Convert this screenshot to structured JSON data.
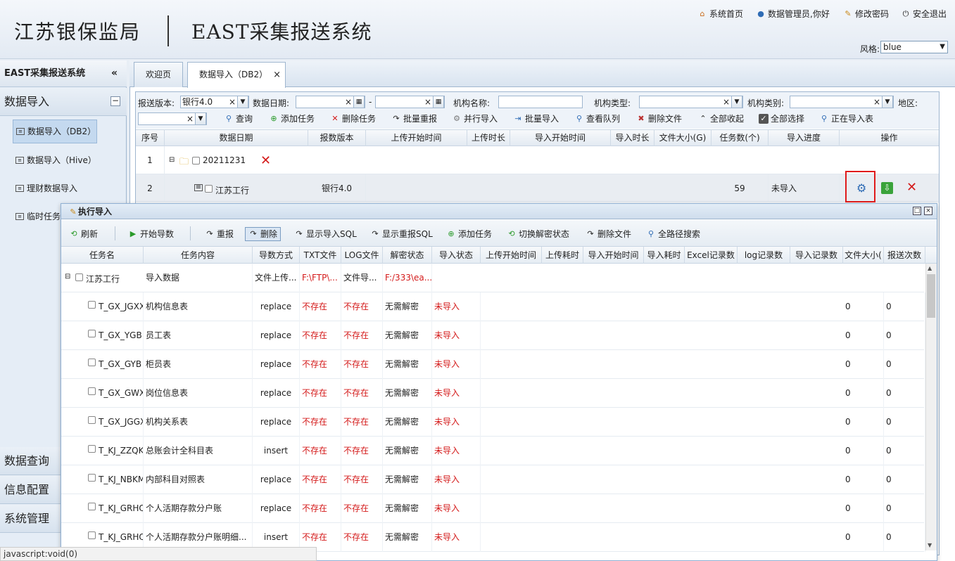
{
  "header": {
    "org_title": "江苏银保监局",
    "system_title": "EAST采集报送系统",
    "links": {
      "home": "系统首页",
      "user": "数据管理员,你好",
      "password": "修改密码",
      "logout": "安全退出"
    },
    "style_label": "风格:",
    "style_value": "blue"
  },
  "sidebar": {
    "title": "EAST采集报送系统",
    "collapse": "«",
    "group_data_import": "数据导入",
    "items": [
      "数据导入（DB2）",
      "数据导入（Hive）",
      "理财数据导入",
      "临时任务"
    ],
    "groups": [
      "数据查询",
      "信息配置",
      "系统管理"
    ]
  },
  "tabs": [
    {
      "label": "欢迎页"
    },
    {
      "label": "数据导入（DB2）",
      "close": "×"
    }
  ],
  "filters": {
    "version_label": "报送版本:",
    "version_value": "银行4.0",
    "date_label": "数据日期:",
    "date_sep": "-",
    "org_name_label": "机构名称:",
    "org_type_label": "机构类型:",
    "org_category_label": "机构类别:",
    "region_label": "地区:"
  },
  "toolbar": {
    "query": "查询",
    "add_task": "添加任务",
    "delete_task": "删除任务",
    "batch_resend": "批量重报",
    "parallel_import": "并行导入",
    "batch_import": "批量导入",
    "view_queue": "查看队列",
    "delete_file": "删除文件",
    "collapse_all": "全部收起",
    "select_all": "全部选择",
    "importing": "正在导入表"
  },
  "grid": {
    "columns": [
      "序号",
      "数据日期",
      "报数版本",
      "上传开始时间",
      "上传时长",
      "导入开始时间",
      "导入时长",
      "文件大小(G)",
      "任务数(个)",
      "导入进度",
      "操作"
    ],
    "rows": [
      {
        "seq": "1",
        "date": "20211231"
      },
      {
        "seq": "2",
        "org": "江苏工行",
        "version": "银行4.0",
        "tasks": "59",
        "progress": "未导入"
      }
    ]
  },
  "dialog": {
    "title": "执行导入",
    "toolbar": [
      "刷新",
      "开始导数",
      "重报",
      "删除",
      "显示导入SQL",
      "显示重报SQL",
      "添加任务",
      "切换解密状态",
      "删除文件",
      "全路径搜索"
    ],
    "columns": [
      "任务名",
      "任务内容",
      "导数方式",
      "TXT文件",
      "LOG文件",
      "解密状态",
      "导入状态",
      "上传开始时间",
      "上传耗时",
      "导入开始时间",
      "导入耗时",
      "Excel记录数",
      "log记录数",
      "导入记录数",
      "文件大小(",
      "报送次数"
    ],
    "parent_row": {
      "name": "江苏工行",
      "content": "导入数据",
      "mode": "文件上传...",
      "txt": "F:\\FTP\\...",
      "log": "文件导...",
      "decrypt": "F:/333\\ea..."
    },
    "rows": [
      {
        "name": "T_GX_JGXX",
        "content": "机构信息表",
        "mode": "replace",
        "txt": "不存在",
        "log": "不存在",
        "decrypt": "无需解密",
        "status": "未导入",
        "size": "0",
        "count": "0"
      },
      {
        "name": "T_GX_YGB",
        "content": "员工表",
        "mode": "replace",
        "txt": "不存在",
        "log": "不存在",
        "decrypt": "无需解密",
        "status": "未导入",
        "size": "0",
        "count": "0"
      },
      {
        "name": "T_GX_GYB",
        "content": "柜员表",
        "mode": "replace",
        "txt": "不存在",
        "log": "不存在",
        "decrypt": "无需解密",
        "status": "未导入",
        "size": "0",
        "count": "0"
      },
      {
        "name": "T_GX_GWXX",
        "content": "岗位信息表",
        "mode": "replace",
        "txt": "不存在",
        "log": "不存在",
        "decrypt": "无需解密",
        "status": "未导入",
        "size": "0",
        "count": "0"
      },
      {
        "name": "T_GX_JGGX",
        "content": "机构关系表",
        "mode": "replace",
        "txt": "不存在",
        "log": "不存在",
        "decrypt": "无需解密",
        "status": "未导入",
        "size": "0",
        "count": "0"
      },
      {
        "name": "T_KJ_ZZQKM",
        "content": "总账会计全科目表",
        "mode": "insert",
        "txt": "不存在",
        "log": "不存在",
        "decrypt": "无需解密",
        "status": "未导入",
        "size": "0",
        "count": "0"
      },
      {
        "name": "T_KJ_NBKMDZ",
        "content": "内部科目对照表",
        "mode": "replace",
        "txt": "不存在",
        "log": "不存在",
        "decrypt": "无需解密",
        "status": "未导入",
        "size": "0",
        "count": "0"
      },
      {
        "name": "T_KJ_GRHQ",
        "content": "个人活期存款分户账",
        "mode": "replace",
        "txt": "不存在",
        "log": "不存在",
        "decrypt": "无需解密",
        "status": "未导入",
        "size": "0",
        "count": "0"
      },
      {
        "name": "T_KJ_GRHQMX",
        "content": "个人活期存款分户账明细...",
        "mode": "insert",
        "txt": "不存在",
        "log": "不存在",
        "decrypt": "无需解密",
        "status": "未导入",
        "size": "0",
        "count": "0"
      }
    ]
  },
  "status_bar": "javascript:void(0)",
  "colors": {
    "accent": "#2f6cb5",
    "danger": "#d41a1a",
    "highlight": "#e01b1b"
  }
}
